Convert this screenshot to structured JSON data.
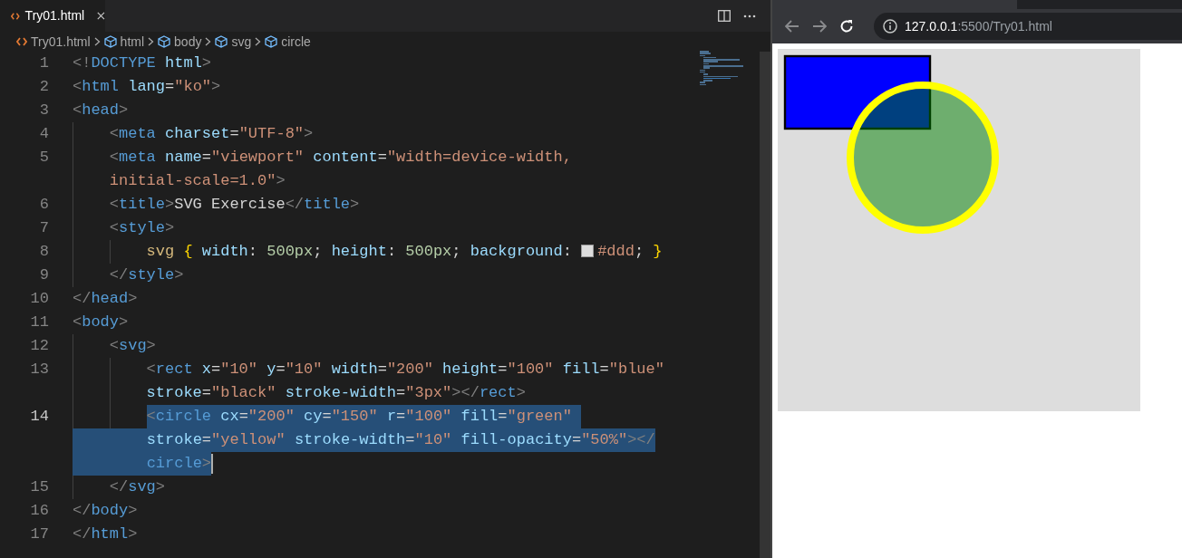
{
  "editor": {
    "tab": {
      "label": "Try01.html",
      "selected": true
    },
    "breadcrumb": [
      {
        "kind": "file",
        "label": "Try01.html"
      },
      {
        "kind": "element",
        "label": "html"
      },
      {
        "kind": "element",
        "label": "body"
      },
      {
        "kind": "element",
        "label": "svg"
      },
      {
        "kind": "element",
        "label": "circle"
      }
    ],
    "lines": [
      {
        "number": "1",
        "kind": "html",
        "selected": false,
        "rows": [
          "<!DOCTYPE html>"
        ]
      },
      {
        "number": "2",
        "kind": "html",
        "selected": false,
        "rows": [
          "<html lang=\"ko\">"
        ]
      },
      {
        "number": "3",
        "kind": "html",
        "selected": false,
        "rows": [
          "<head>"
        ]
      },
      {
        "number": "4",
        "kind": "html",
        "selected": false,
        "rows": [
          "    <meta charset=\"UTF-8\">"
        ]
      },
      {
        "number": "5",
        "kind": "html",
        "selected": false,
        "rows": [
          "    <meta name=\"viewport\" content=\"width=device-width,",
          "    initial-scale=1.0\">"
        ]
      },
      {
        "number": "6",
        "kind": "html",
        "selected": false,
        "rows": [
          "    <title>SVG Exercise</title>"
        ]
      },
      {
        "number": "7",
        "kind": "html",
        "selected": false,
        "rows": [
          "    <style>"
        ]
      },
      {
        "number": "8",
        "kind": "css",
        "selected": false,
        "color": "#dddddd",
        "rows": [
          "        svg { width: 500px; height: 500px; background: #ddd; }"
        ]
      },
      {
        "number": "9",
        "kind": "html",
        "selected": false,
        "rows": [
          "    </style>"
        ]
      },
      {
        "number": "10",
        "kind": "html",
        "selected": false,
        "rows": [
          "</head>"
        ]
      },
      {
        "number": "11",
        "kind": "html",
        "selected": false,
        "rows": [
          "<body>"
        ]
      },
      {
        "number": "12",
        "kind": "html",
        "selected": false,
        "rows": [
          "    <svg>"
        ]
      },
      {
        "number": "13",
        "kind": "html",
        "selected": false,
        "rows": [
          "        <rect x=\"10\" y=\"10\" width=\"200\" height=\"100\" fill=\"blue\"",
          "        stroke=\"black\" stroke-width=\"3px\"></rect>"
        ]
      },
      {
        "number": "14",
        "kind": "html",
        "selected": true,
        "rows": [
          "        <circle cx=\"200\" cy=\"150\" r=\"100\" fill=\"green\" ",
          "        stroke=\"yellow\" stroke-width=\"10\" fill-opacity=\"50%\"></",
          "        circle>"
        ]
      },
      {
        "number": "15",
        "kind": "html",
        "selected": false,
        "rows": [
          "    </svg>"
        ]
      },
      {
        "number": "16",
        "kind": "html",
        "selected": false,
        "rows": [
          "</body>"
        ]
      },
      {
        "number": "17",
        "kind": "html",
        "selected": false,
        "rows": [
          "</html>"
        ]
      }
    ]
  },
  "browser": {
    "address_host": "127.0.0.1",
    "address_path": ":5500/Try01.html"
  }
}
